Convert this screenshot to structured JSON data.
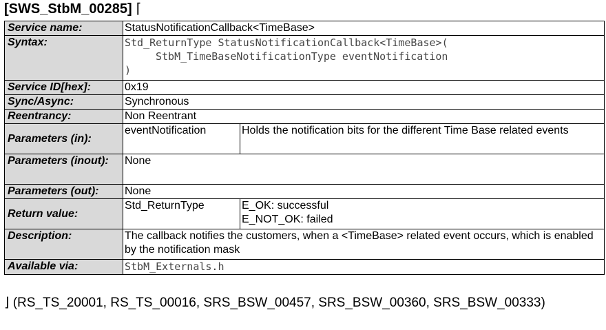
{
  "requirement": {
    "id": "[SWS_StbM_00285]",
    "open_mark": "⌈"
  },
  "table": {
    "service_name": {
      "label": "Service name:",
      "value": "StatusNotificationCallback<TimeBase>"
    },
    "syntax": {
      "label": "Syntax:",
      "lines": [
        "Std_ReturnType StatusNotificationCallback<TimeBase>(",
        "StbM_TimeBaseNotificationType eventNotification",
        ")"
      ]
    },
    "service_id": {
      "label": "Service ID[hex]:",
      "value": "0x19"
    },
    "sync": {
      "label": "Sync/Async:",
      "value": "Synchronous"
    },
    "reentrancy": {
      "label": "Reentrancy:",
      "value": "Non Reentrant"
    },
    "params_in": {
      "label": "Parameters (in):",
      "name": "eventNotification",
      "desc": "Holds the notification bits for the different Time Base related events"
    },
    "params_inout": {
      "label": "Parameters (inout):",
      "value": "None"
    },
    "params_out": {
      "label": "Parameters (out):",
      "value": "None"
    },
    "return_value": {
      "label": "Return value:",
      "type": "Std_ReturnType",
      "values": [
        "E_OK: successful",
        "E_NOT_OK: failed"
      ]
    },
    "description": {
      "label": "Description:",
      "value": "The callback notifies the customers, when a <TimeBase> related event occurs, which is enabled by the notification mask"
    },
    "available_via": {
      "label": "Available via:",
      "value": "StbM_Externals.h"
    }
  },
  "footer": {
    "text": "⌋ (RS_TS_20001, RS_TS_00016, SRS_BSW_00457, SRS_BSW_00360, SRS_BSW_00333)"
  }
}
